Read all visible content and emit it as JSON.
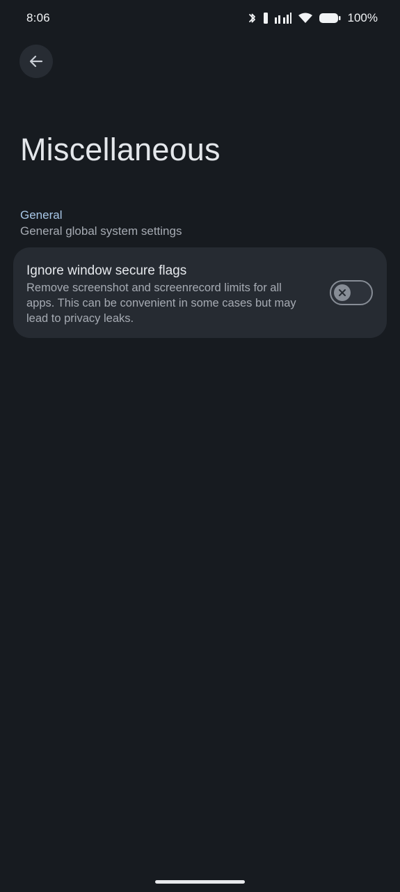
{
  "status_bar": {
    "time": "8:06",
    "battery_percent": "100%",
    "icons": [
      "bluetooth-icon",
      "vibrate-icon",
      "signal-icon",
      "wifi-icon",
      "battery-icon"
    ]
  },
  "header": {
    "back_icon": "arrow-left-icon",
    "title": "Miscellaneous"
  },
  "section": {
    "title": "General",
    "subtitle": "General global system settings"
  },
  "settings": [
    {
      "title": "Ignore window secure flags",
      "description": "Remove screenshot and screenrecord limits for all apps. This can be convenient in some cases but may lead to privacy leaks.",
      "enabled": false
    }
  ],
  "colors": {
    "background": "#171b20",
    "card": "#262b32",
    "section_accent": "#a9c8e8"
  }
}
